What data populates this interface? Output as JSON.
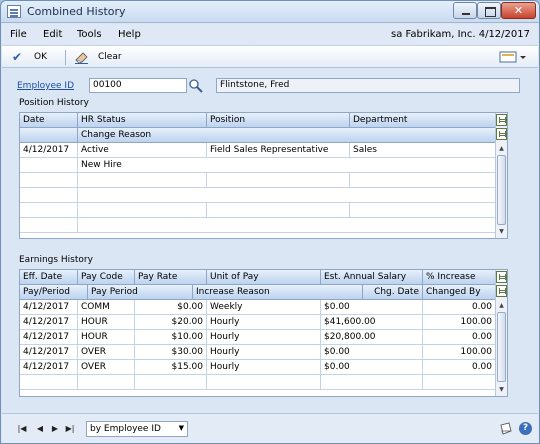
{
  "window": {
    "title": "Combined History"
  },
  "menu": {
    "items": [
      "File",
      "Edit",
      "Tools",
      "Help"
    ],
    "user_info": "sa  Fabrikam, Inc.  4/12/2017"
  },
  "toolbar": {
    "ok_label": "OK",
    "clear_label": "Clear"
  },
  "employee": {
    "id_label": "Employee ID",
    "id_value": "00100",
    "name_value": "Flintstone, Fred"
  },
  "position_history": {
    "section_label": "Position History",
    "headers": [
      "Date",
      "HR Status",
      "Position",
      "Department"
    ],
    "subheader": "Change Reason",
    "rows": [
      {
        "date": "4/12/2017",
        "status": "Active",
        "position": "Field Sales Representative",
        "department": "Sales",
        "reason": "New Hire"
      }
    ]
  },
  "earnings_history": {
    "section_label": "Earnings History",
    "headers": [
      "Eff. Date",
      "Pay Code",
      "Pay Rate",
      "Unit of Pay",
      "Est. Annual Salary",
      "% Increase"
    ],
    "subheaders": [
      "Pay/Period",
      "Pay Period",
      "Increase Reason",
      "Chg. Date",
      "Changed By"
    ],
    "rows": [
      {
        "date": "4/12/2017",
        "code": "COMM",
        "rate": "$0.00",
        "unit": "Weekly",
        "salary": "$0.00",
        "increase": "0.00"
      },
      {
        "date": "4/12/2017",
        "code": "HOUR",
        "rate": "$20.00",
        "unit": "Hourly",
        "salary": "$41,600.00",
        "increase": "100.00"
      },
      {
        "date": "4/12/2017",
        "code": "HOUR",
        "rate": "$10.00",
        "unit": "Hourly",
        "salary": "$20,800.00",
        "increase": "0.00"
      },
      {
        "date": "4/12/2017",
        "code": "OVER",
        "rate": "$30.00",
        "unit": "Hourly",
        "salary": "$0.00",
        "increase": "100.00"
      },
      {
        "date": "4/12/2017",
        "code": "OVER",
        "rate": "$15.00",
        "unit": "Hourly",
        "salary": "$0.00",
        "increase": "0.00"
      }
    ]
  },
  "status": {
    "sort_option": "by Employee ID"
  }
}
